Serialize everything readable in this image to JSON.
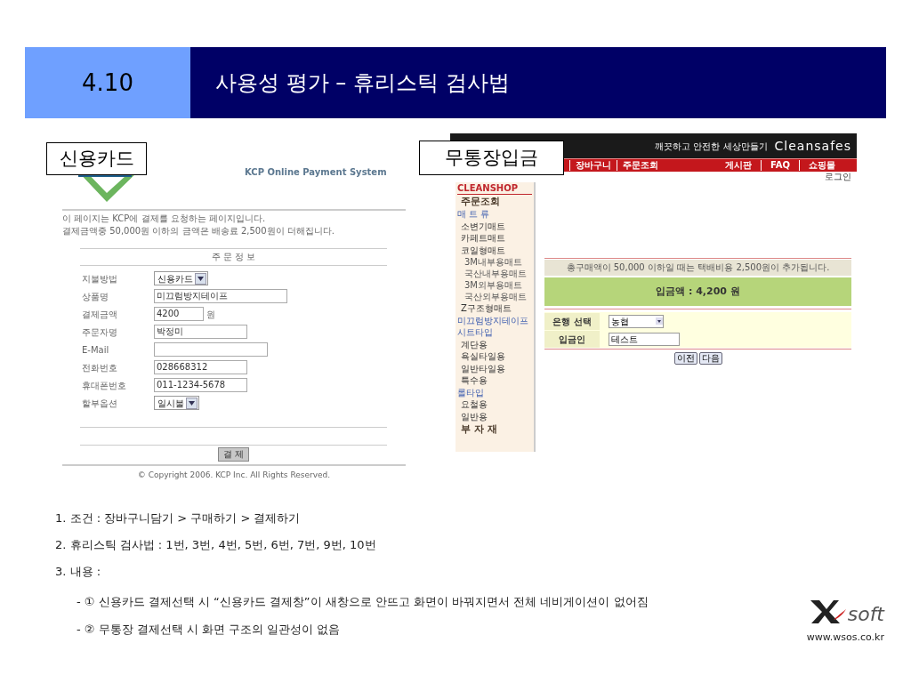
{
  "slide": {
    "section_number": "4.10",
    "title": "사용성 평가 – 휴리스틱 검사법"
  },
  "card_payment": {
    "label": "신용카드",
    "system_title": "KCP Online Payment System",
    "intro": [
      "이 페이지는 KCP에 결제를 요청하는 페이지입니다.",
      "결제금액중 50,000원 이하의 금액은 배송료 2,500원이 더해집니다."
    ],
    "form_title": "주 문 정 보",
    "fields": [
      {
        "label": "지불방법",
        "kind": "select",
        "value": "신용카드"
      },
      {
        "label": "상품명",
        "kind": "input",
        "value": "미끄럼방지테이프"
      },
      {
        "label": "결제금액",
        "kind": "input",
        "value": "4200",
        "suffix": "원"
      },
      {
        "label": "주문자명",
        "kind": "input",
        "value": "박정미"
      },
      {
        "label": "E-Mail",
        "kind": "input"
      },
      {
        "label": "전화번호",
        "kind": "input",
        "value": "028668312"
      },
      {
        "label": "휴대폰번호",
        "kind": "input",
        "value": "011-1234-5678"
      },
      {
        "label": "할부옵션",
        "kind": "select",
        "value": "일시불"
      }
    ],
    "submit": "결 제",
    "copyright": "© Copyright 2006. KCP Inc. All Rights Reserved."
  },
  "bank_transfer": {
    "label": "무통장입금",
    "tagline": "깨끗하고 안전한 세상만들기",
    "logo": "Cleansafes",
    "nav_left": [
      "장바구니",
      "주문조회"
    ],
    "nav_right": [
      "게시판",
      "FAQ",
      "쇼핑몰"
    ],
    "login": "로그인",
    "sidebar": [
      {
        "text": "CLEANSHOP",
        "kind": "brand"
      },
      {
        "text": "주문조회",
        "kind": "title"
      },
      {
        "text": "매 트 류",
        "kind": "category"
      },
      {
        "text": "소변기매트",
        "kind": "item"
      },
      {
        "text": "카페트매트",
        "kind": "item"
      },
      {
        "text": "코일형매트",
        "kind": "item"
      },
      {
        "text": "3M내부용매트",
        "kind": "sub"
      },
      {
        "text": "국산내부용매트",
        "kind": "sub"
      },
      {
        "text": "3M외부용매트",
        "kind": "sub"
      },
      {
        "text": "국산외부용매트",
        "kind": "sub"
      },
      {
        "text": "Z구조형매트",
        "kind": "item"
      },
      {
        "text": "미끄럼방지테이프",
        "kind": "category"
      },
      {
        "text": "시트타입",
        "kind": "category"
      },
      {
        "text": "계단용",
        "kind": "item"
      },
      {
        "text": "욕실타일용",
        "kind": "item"
      },
      {
        "text": "일반타일용",
        "kind": "item"
      },
      {
        "text": "특수용",
        "kind": "item"
      },
      {
        "text": "롤타입",
        "kind": "category"
      },
      {
        "text": "요철용",
        "kind": "item"
      },
      {
        "text": "일반용",
        "kind": "item"
      },
      {
        "text": "부 자 재",
        "kind": "title"
      }
    ],
    "notice": "총구매액이 50,000 이하일 때는 택배비용 2,500원이 추가됩니다.",
    "amount": "입금액 : 4,200 원",
    "fields": [
      {
        "label": "은행 선택",
        "kind": "select",
        "value": "농협"
      },
      {
        "label": "입금인",
        "kind": "input",
        "value": "테스트"
      }
    ],
    "buttons": [
      "이전",
      "다음"
    ]
  },
  "notes": [
    {
      "text": "1. 조건 : 장바구니담기 > 구매하기 > 결제하기",
      "kind": "numbered"
    },
    {
      "text": "2. 휴리스틱 검사법 : 1번, 3번, 4번, 5번, 6번, 7번, 9번, 10번",
      "kind": "numbered"
    },
    {
      "text": "3. 내용 :",
      "kind": "numbered"
    },
    {
      "text": "- ① 신용카드 결제선택 시 “신용카드 결제창”이 새창으로 안뜨고 화면이 바꿔지면서 전체 네비게이션이 없어짐",
      "kind": "sub"
    },
    {
      "text": "- ② 무통장 결제선택 시 화면 구조의 일관성이 없음",
      "kind": "sub"
    }
  ],
  "footer": {
    "brand": "soft",
    "url": "www.wsos.co.kr"
  }
}
